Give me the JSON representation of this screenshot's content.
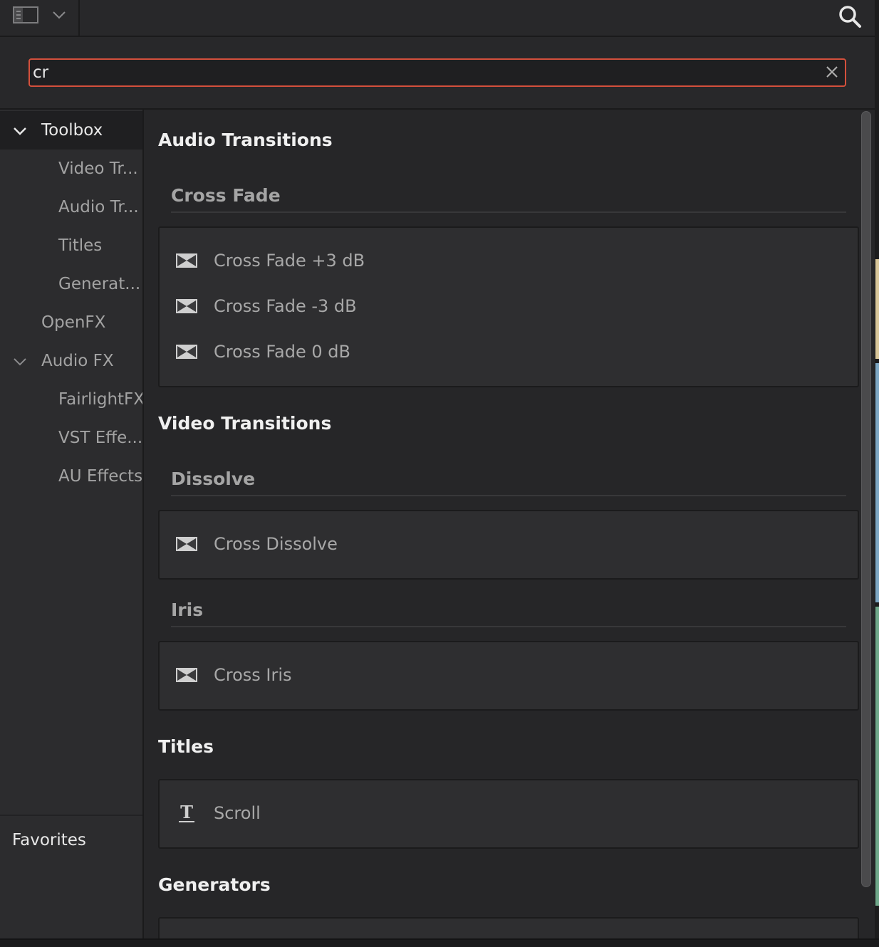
{
  "search": {
    "value": "cr"
  },
  "sidebar": {
    "items": [
      {
        "label": "Toolbox",
        "level": 1,
        "expanded": true,
        "selected": true
      },
      {
        "label": "Video Tr...",
        "level": 2
      },
      {
        "label": "Audio Tr...",
        "level": 2
      },
      {
        "label": "Titles",
        "level": 2
      },
      {
        "label": "Generat...",
        "level": 2
      },
      {
        "label": "OpenFX",
        "level": 1
      },
      {
        "label": "Audio FX",
        "level": 1,
        "expanded": true
      },
      {
        "label": "FairlightFX",
        "level": 2
      },
      {
        "label": "VST Effe...",
        "level": 2
      },
      {
        "label": "AU Effects",
        "level": 2
      }
    ],
    "favorites_label": "Favorites"
  },
  "main": {
    "audio_transitions": {
      "title": "Audio Transitions",
      "groups": [
        {
          "title": "Cross Fade",
          "items": [
            "Cross Fade +3 dB",
            "Cross Fade -3 dB",
            "Cross Fade 0 dB"
          ]
        }
      ]
    },
    "video_transitions": {
      "title": "Video Transitions",
      "groups": [
        {
          "title": "Dissolve",
          "items": [
            "Cross Dissolve"
          ]
        },
        {
          "title": "Iris",
          "items": [
            "Cross Iris"
          ]
        }
      ]
    },
    "titles": {
      "title": "Titles",
      "items": [
        "Scroll"
      ]
    },
    "generators": {
      "title": "Generators"
    }
  },
  "colors": {
    "search_border": "#d4503c",
    "edge_segments": [
      "#d9c79a",
      "#7da7c4",
      "#6fa88a"
    ]
  },
  "icons": {
    "transition": "transition-icon",
    "title": "title-t-icon"
  }
}
